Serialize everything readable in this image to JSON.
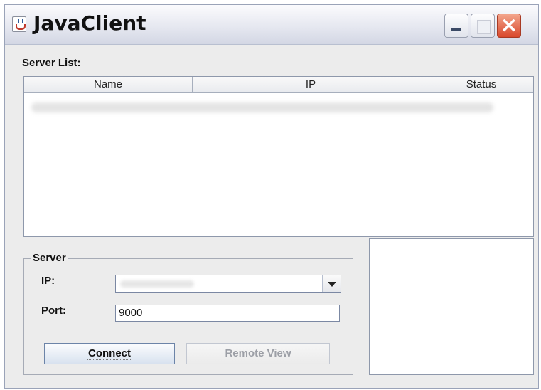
{
  "window": {
    "title": "JavaClient",
    "controls": {
      "minimize": "minimize",
      "maximize": "maximize",
      "close": "×"
    }
  },
  "server_list": {
    "label": "Server List:",
    "columns": [
      "Name",
      "IP",
      "Status"
    ]
  },
  "server_group": {
    "label": "Server",
    "ip_label": "IP:",
    "ip_value": "",
    "port_label": "Port:",
    "port_value": "9000",
    "connect_label": "Connect",
    "remote_view_label": "Remote View"
  }
}
